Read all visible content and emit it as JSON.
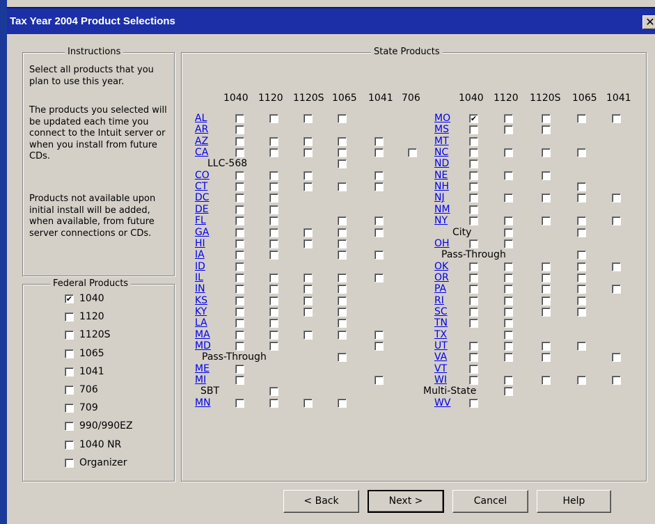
{
  "window": {
    "title": "Tax Year 2004 Product Selections",
    "close_glyph": "✕"
  },
  "instructions": {
    "legend": "Instructions",
    "para1": "Select all products that you plan to use this year.",
    "para2": "The products you selected will be updated each time you connect to the Intuit server or when you install from future CDs.",
    "para3": "Products not available upon initial install will be added, when available, from future server connections or CDs."
  },
  "federal": {
    "legend": "Federal Products",
    "items": [
      {
        "label": "1040",
        "checked": true
      },
      {
        "label": "1120",
        "checked": false
      },
      {
        "label": "1120S",
        "checked": false
      },
      {
        "label": "1065",
        "checked": false
      },
      {
        "label": "1041",
        "checked": false
      },
      {
        "label": "706",
        "checked": false
      },
      {
        "label": "709",
        "checked": false
      },
      {
        "label": "990/990EZ",
        "checked": false
      },
      {
        "label": "1040 NR",
        "checked": false
      },
      {
        "label": "Organizer",
        "checked": false
      }
    ]
  },
  "state": {
    "legend": "State Products",
    "left_columns": [
      "1040",
      "1120",
      "1120S",
      "1065",
      "1041",
      "706"
    ],
    "right_columns": [
      "1040",
      "1120",
      "1120S",
      "1065",
      "1041"
    ],
    "left_rows": [
      {
        "label": "AL",
        "link": true,
        "boxes": [
          1,
          1,
          1,
          1,
          0,
          0
        ]
      },
      {
        "label": "AR",
        "link": true,
        "boxes": [
          1,
          0,
          0,
          0,
          0,
          0
        ]
      },
      {
        "label": "AZ",
        "link": true,
        "boxes": [
          1,
          1,
          1,
          1,
          1,
          0
        ]
      },
      {
        "label": "CA",
        "link": true,
        "boxes": [
          1,
          1,
          1,
          1,
          1,
          1
        ]
      },
      {
        "label": "LLC-568",
        "link": false,
        "boxes": [
          0,
          0,
          0,
          1,
          0,
          0
        ]
      },
      {
        "label": "CO",
        "link": true,
        "boxes": [
          1,
          1,
          1,
          0,
          1,
          0
        ]
      },
      {
        "label": "CT",
        "link": true,
        "boxes": [
          1,
          1,
          1,
          1,
          1,
          0
        ]
      },
      {
        "label": "DC",
        "link": true,
        "boxes": [
          1,
          1,
          0,
          0,
          0,
          0
        ]
      },
      {
        "label": "DE",
        "link": true,
        "boxes": [
          1,
          1,
          0,
          0,
          0,
          0
        ]
      },
      {
        "label": "FL",
        "link": true,
        "boxes": [
          1,
          1,
          0,
          1,
          1,
          0
        ]
      },
      {
        "label": "GA",
        "link": true,
        "boxes": [
          1,
          1,
          1,
          1,
          1,
          0
        ]
      },
      {
        "label": "HI",
        "link": true,
        "boxes": [
          1,
          1,
          1,
          1,
          0,
          0
        ]
      },
      {
        "label": "IA",
        "link": true,
        "boxes": [
          1,
          1,
          0,
          1,
          1,
          0
        ]
      },
      {
        "label": "ID",
        "link": true,
        "boxes": [
          1,
          0,
          0,
          0,
          0,
          0
        ]
      },
      {
        "label": "IL",
        "link": true,
        "boxes": [
          1,
          1,
          1,
          1,
          1,
          0
        ]
      },
      {
        "label": "IN",
        "link": true,
        "boxes": [
          1,
          1,
          1,
          1,
          0,
          0
        ]
      },
      {
        "label": "KS",
        "link": true,
        "boxes": [
          1,
          1,
          1,
          1,
          0,
          0
        ]
      },
      {
        "label": "KY",
        "link": true,
        "boxes": [
          1,
          1,
          1,
          1,
          0,
          0
        ]
      },
      {
        "label": "LA",
        "link": true,
        "boxes": [
          1,
          1,
          0,
          1,
          0,
          0
        ]
      },
      {
        "label": "MA",
        "link": true,
        "boxes": [
          1,
          1,
          1,
          1,
          1,
          0
        ]
      },
      {
        "label": "MD",
        "link": true,
        "boxes": [
          1,
          1,
          0,
          0,
          1,
          0
        ]
      },
      {
        "label": "Pass-Through",
        "link": false,
        "boxes": [
          0,
          0,
          0,
          1,
          0,
          0
        ]
      },
      {
        "label": "ME",
        "link": true,
        "boxes": [
          1,
          0,
          0,
          0,
          0,
          0
        ]
      },
      {
        "label": "MI",
        "link": true,
        "boxes": [
          1,
          0,
          0,
          0,
          1,
          0
        ]
      },
      {
        "label": "SBT",
        "link": false,
        "boxes": [
          0,
          1,
          0,
          0,
          0,
          0
        ]
      },
      {
        "label": "MN",
        "link": true,
        "boxes": [
          1,
          1,
          1,
          1,
          0,
          0
        ]
      }
    ],
    "right_rows": [
      {
        "label": "MO",
        "link": true,
        "boxes": [
          2,
          1,
          1,
          1,
          1
        ]
      },
      {
        "label": "MS",
        "link": true,
        "boxes": [
          1,
          1,
          1,
          0,
          0
        ]
      },
      {
        "label": "MT",
        "link": true,
        "boxes": [
          1,
          0,
          0,
          0,
          0
        ]
      },
      {
        "label": "NC",
        "link": true,
        "boxes": [
          1,
          1,
          1,
          1,
          0
        ]
      },
      {
        "label": "ND",
        "link": true,
        "boxes": [
          1,
          0,
          0,
          0,
          0
        ]
      },
      {
        "label": "NE",
        "link": true,
        "boxes": [
          1,
          1,
          1,
          0,
          0
        ]
      },
      {
        "label": "NH",
        "link": true,
        "boxes": [
          1,
          0,
          0,
          1,
          0
        ]
      },
      {
        "label": "NJ",
        "link": true,
        "boxes": [
          1,
          1,
          1,
          1,
          1
        ]
      },
      {
        "label": "NM",
        "link": true,
        "boxes": [
          1,
          0,
          0,
          0,
          0
        ]
      },
      {
        "label": "NY",
        "link": true,
        "boxes": [
          1,
          1,
          1,
          1,
          1
        ]
      },
      {
        "label": "City",
        "link": false,
        "boxes": [
          0,
          1,
          0,
          1,
          0
        ]
      },
      {
        "label": "OH",
        "link": true,
        "boxes": [
          1,
          1,
          0,
          0,
          0
        ]
      },
      {
        "label": "Pass-Through",
        "link": false,
        "boxes": [
          0,
          0,
          0,
          1,
          0
        ]
      },
      {
        "label": "OK",
        "link": true,
        "boxes": [
          1,
          1,
          1,
          1,
          1
        ]
      },
      {
        "label": "OR",
        "link": true,
        "boxes": [
          1,
          1,
          1,
          1,
          0
        ]
      },
      {
        "label": "PA",
        "link": true,
        "boxes": [
          1,
          1,
          1,
          1,
          1
        ]
      },
      {
        "label": "RI",
        "link": true,
        "boxes": [
          1,
          1,
          1,
          1,
          0
        ]
      },
      {
        "label": "SC",
        "link": true,
        "boxes": [
          1,
          1,
          1,
          1,
          0
        ]
      },
      {
        "label": "TN",
        "link": true,
        "boxes": [
          1,
          1,
          0,
          0,
          0
        ]
      },
      {
        "label": "TX",
        "link": true,
        "boxes": [
          0,
          1,
          0,
          0,
          0
        ]
      },
      {
        "label": "UT",
        "link": true,
        "boxes": [
          1,
          1,
          1,
          1,
          0
        ]
      },
      {
        "label": "VA",
        "link": true,
        "boxes": [
          1,
          1,
          1,
          0,
          1
        ]
      },
      {
        "label": "VT",
        "link": true,
        "boxes": [
          1,
          0,
          0,
          0,
          0
        ]
      },
      {
        "label": "WI",
        "link": true,
        "boxes": [
          1,
          1,
          1,
          1,
          1
        ]
      },
      {
        "label": "Multi-State",
        "link": false,
        "boxes": [
          0,
          1,
          0,
          0,
          0
        ]
      },
      {
        "label": "WV",
        "link": true,
        "boxes": [
          1,
          0,
          0,
          0,
          0
        ]
      }
    ]
  },
  "buttons": {
    "back": "< Back",
    "next": "Next >",
    "cancel": "Cancel",
    "help": "Help"
  }
}
